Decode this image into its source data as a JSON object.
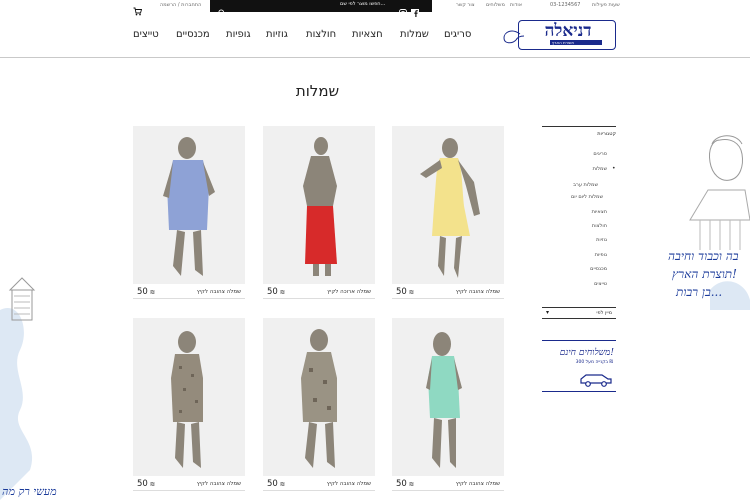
{
  "topbar": {
    "cart_icon": "cart-icon",
    "account_link": "התחברות / הרשמה",
    "search_icon": "search-icon",
    "search_placeholder": "חפשו מוצר לפי שם...",
    "social_icons": [
      "instagram-icon",
      "facebook-icon"
    ],
    "phone": "03-1234567",
    "store_hours": "שעות פעילות",
    "links": [
      "אודות",
      "משלוחים",
      "צור קשר"
    ]
  },
  "header": {
    "logo_name": "דניאלה",
    "logo_sub": "תוצרת הארץ",
    "nav": [
      "סריגים",
      "שמלות",
      "חצאיות",
      "חולצות",
      "גוזיות",
      "גופיות",
      "מכנסיים",
      "טייצים"
    ]
  },
  "page": {
    "title": "שמלות"
  },
  "products": [
    {
      "name": "שמלה צהובה לקיץ",
      "price": "50",
      "currency": "₪",
      "image": "yellow-dress"
    },
    {
      "name": "שמלה ארוכה לקיץ",
      "price": "50",
      "currency": "₪",
      "image": "red-dress"
    },
    {
      "name": "שמלה צהובה לקיץ",
      "price": "50",
      "currency": "₪",
      "image": "blue-dress"
    },
    {
      "name": "שמלה צהובה לקיץ",
      "price": "50",
      "currency": "₪",
      "image": "mint-dress"
    },
    {
      "name": "שמלה צהובה לקיץ",
      "price": "50",
      "currency": "₪",
      "image": "floral-dress"
    },
    {
      "name": "שמלה צהובה לקיץ",
      "price": "50",
      "currency": "₪",
      "image": "print-dress"
    }
  ],
  "sidebar": {
    "header": "קטגוריות",
    "categories": [
      {
        "label": "סריגים"
      },
      {
        "label": "שמלות",
        "active": true
      },
      {
        "label": "חצאיות"
      },
      {
        "label": "חולצות"
      },
      {
        "label": "גוזיות"
      },
      {
        "label": "גופיות"
      },
      {
        "label": "מכנסיים"
      },
      {
        "label": "טייצים"
      }
    ],
    "subcategories": [
      "שמלות ערב",
      "שמלות ליום יום"
    ],
    "sort_label": "מיין לפי",
    "promo_title": "משלוחים חינם!",
    "promo_sub": "בקנייה מעל 300 ₪"
  },
  "decor": {
    "right_lines": [
      "בה וכבוד וחיבה",
      "תוצרת הארץ!",
      "בן רבות..."
    ],
    "left_line": "מעשי רק מה"
  }
}
